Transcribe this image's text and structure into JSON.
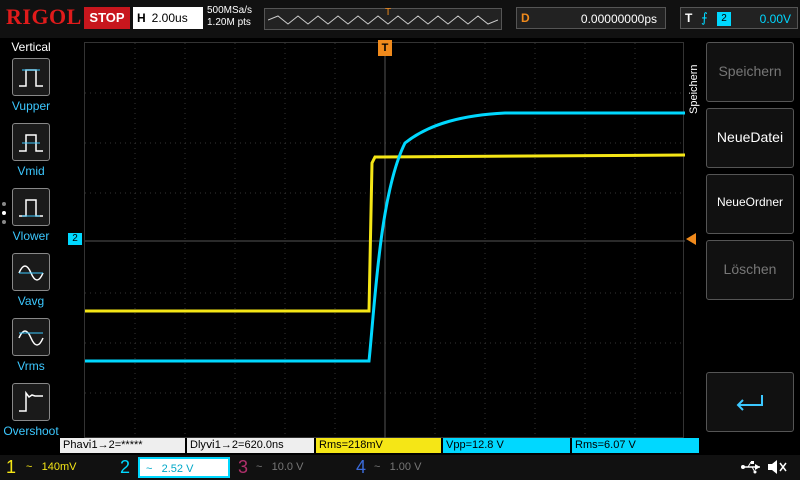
{
  "brand": "RIGOL",
  "run_state": "STOP",
  "timebase": {
    "label": "H",
    "value": "2.00us"
  },
  "acquisition": {
    "sample_rate": "500MSa/s",
    "points": "1.20M pts"
  },
  "delay": {
    "label": "D",
    "value": "0.00000000ps"
  },
  "trigger": {
    "label": "T",
    "source": "2",
    "level": "0.00V"
  },
  "left_menu": {
    "title": "Vertical",
    "items": [
      {
        "label": "Vupper"
      },
      {
        "label": "Vmid"
      },
      {
        "label": "Vlower"
      },
      {
        "label": "Vavg"
      },
      {
        "label": "Vrms"
      },
      {
        "label": "Overshoot"
      }
    ]
  },
  "right_menu": {
    "title": "Speichern",
    "buttons": [
      {
        "label": "Speichern",
        "enabled": false
      },
      {
        "label": "NeueDatei",
        "enabled": true
      },
      {
        "label": "NeueOrdner",
        "enabled": true
      },
      {
        "label": "Löschen",
        "enabled": false
      }
    ]
  },
  "markers": {
    "trigger_top": "T",
    "ch2_level": "2"
  },
  "measurements": [
    "Phaⅵ1→2=*****",
    "Dlyⅵ1→2=620.0ns",
    "Rms=218mV",
    "Vpp=12.8 V",
    "Rms=6.07 V"
  ],
  "channels": [
    {
      "num": "1",
      "coupling": "~",
      "scale": "140mV",
      "color": "#f5e616",
      "active": false
    },
    {
      "num": "2",
      "coupling": "~",
      "scale": "2.52 V",
      "color": "#00d8ff",
      "active": true
    },
    {
      "num": "3",
      "coupling": "~",
      "scale": "10.0 V",
      "color": "#b0306c",
      "active": false
    },
    {
      "num": "4",
      "coupling": "~",
      "scale": "1.00 V",
      "color": "#3a6ad8",
      "active": false
    }
  ],
  "colors": {
    "ch1": "#f5e616",
    "ch2": "#00d8ff",
    "trigger": "#f08a1c",
    "stop": "#c8161d",
    "brand": "#e01b1b"
  }
}
